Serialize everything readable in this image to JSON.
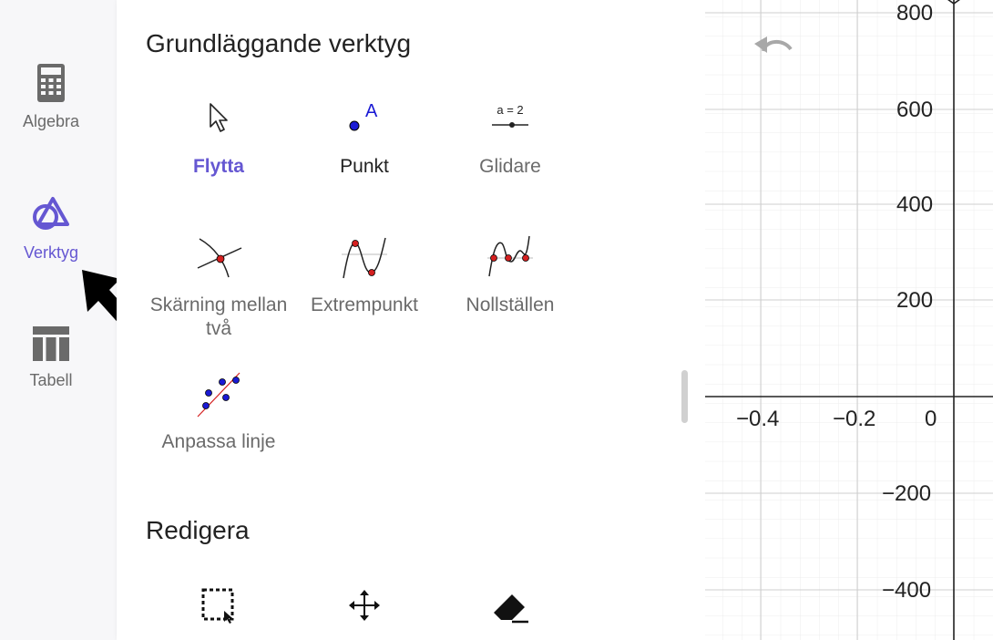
{
  "sidebar": {
    "items": [
      {
        "label": "Algebra",
        "icon": "calculator-icon"
      },
      {
        "label": "Verktyg",
        "icon": "tools-icon",
        "active": true
      },
      {
        "label": "Tabell",
        "icon": "table-icon"
      }
    ]
  },
  "tools_panel": {
    "basic_section": {
      "title": "Grundläggande verktyg",
      "tools": [
        {
          "label": "Flytta",
          "icon": "move-cursor-icon",
          "selected": true
        },
        {
          "label": "Punkt",
          "icon": "point-icon",
          "point_letter": "A"
        },
        {
          "label": "Glidare",
          "icon": "slider-icon",
          "slider_text": "a = 2"
        },
        {
          "label": "Skärning mellan två",
          "icon": "intersect-icon"
        },
        {
          "label": "Extrempunkt",
          "icon": "extremum-icon"
        },
        {
          "label": "Nollställen",
          "icon": "roots-icon"
        },
        {
          "label": "Anpassa linje",
          "icon": "fit-line-icon"
        }
      ]
    },
    "edit_section": {
      "title": "Redigera",
      "tools": [
        {
          "icon": "select-objects-icon"
        },
        {
          "icon": "move-graphics-icon"
        },
        {
          "icon": "eraser-icon"
        }
      ]
    }
  },
  "graphics": {
    "x_ticks": [
      "−0.4",
      "−0.2",
      "0"
    ],
    "y_ticks": [
      "800",
      "600",
      "400",
      "200",
      "−200",
      "−400"
    ],
    "undo_icon": "undo-icon"
  },
  "colors": {
    "accent": "#6557d2",
    "point_blue": "#1a1ad4",
    "point_red": "#d42020"
  }
}
